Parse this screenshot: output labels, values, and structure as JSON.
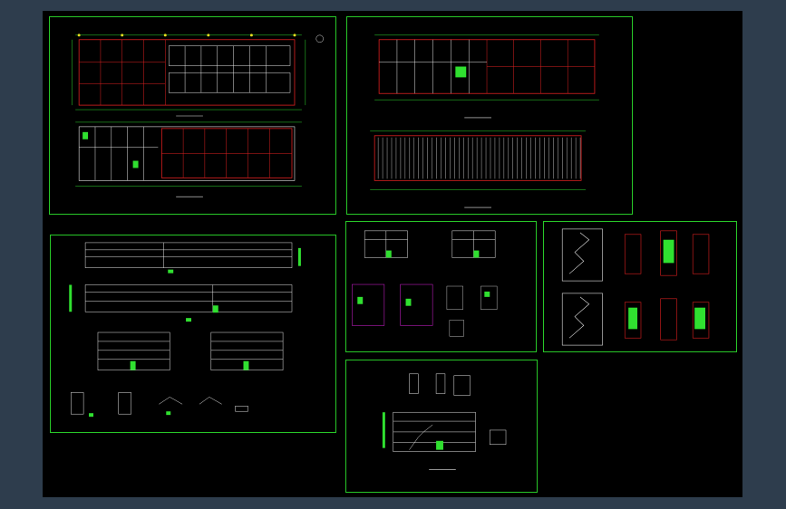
{
  "viewer": {
    "background_color": "#2e3d4d",
    "canvas_color": "#000000",
    "frame_color": "#28c828"
  },
  "sheets": [
    {
      "id": "sheet-plans-1",
      "captions": []
    },
    {
      "id": "sheet-plans-2",
      "captions": []
    },
    {
      "id": "sheet-elevations",
      "captions": []
    },
    {
      "id": "sheet-details-a",
      "captions": []
    },
    {
      "id": "sheet-stairs",
      "captions": []
    },
    {
      "id": "sheet-section",
      "captions": []
    }
  ],
  "colors": {
    "grid_red": "#e02020",
    "wall_white": "#e8e8e8",
    "dim_green": "#30e030",
    "axis_yellow": "#e8e020",
    "accent_cyan": "#20d8e8",
    "accent_magenta": "#e020e0"
  }
}
